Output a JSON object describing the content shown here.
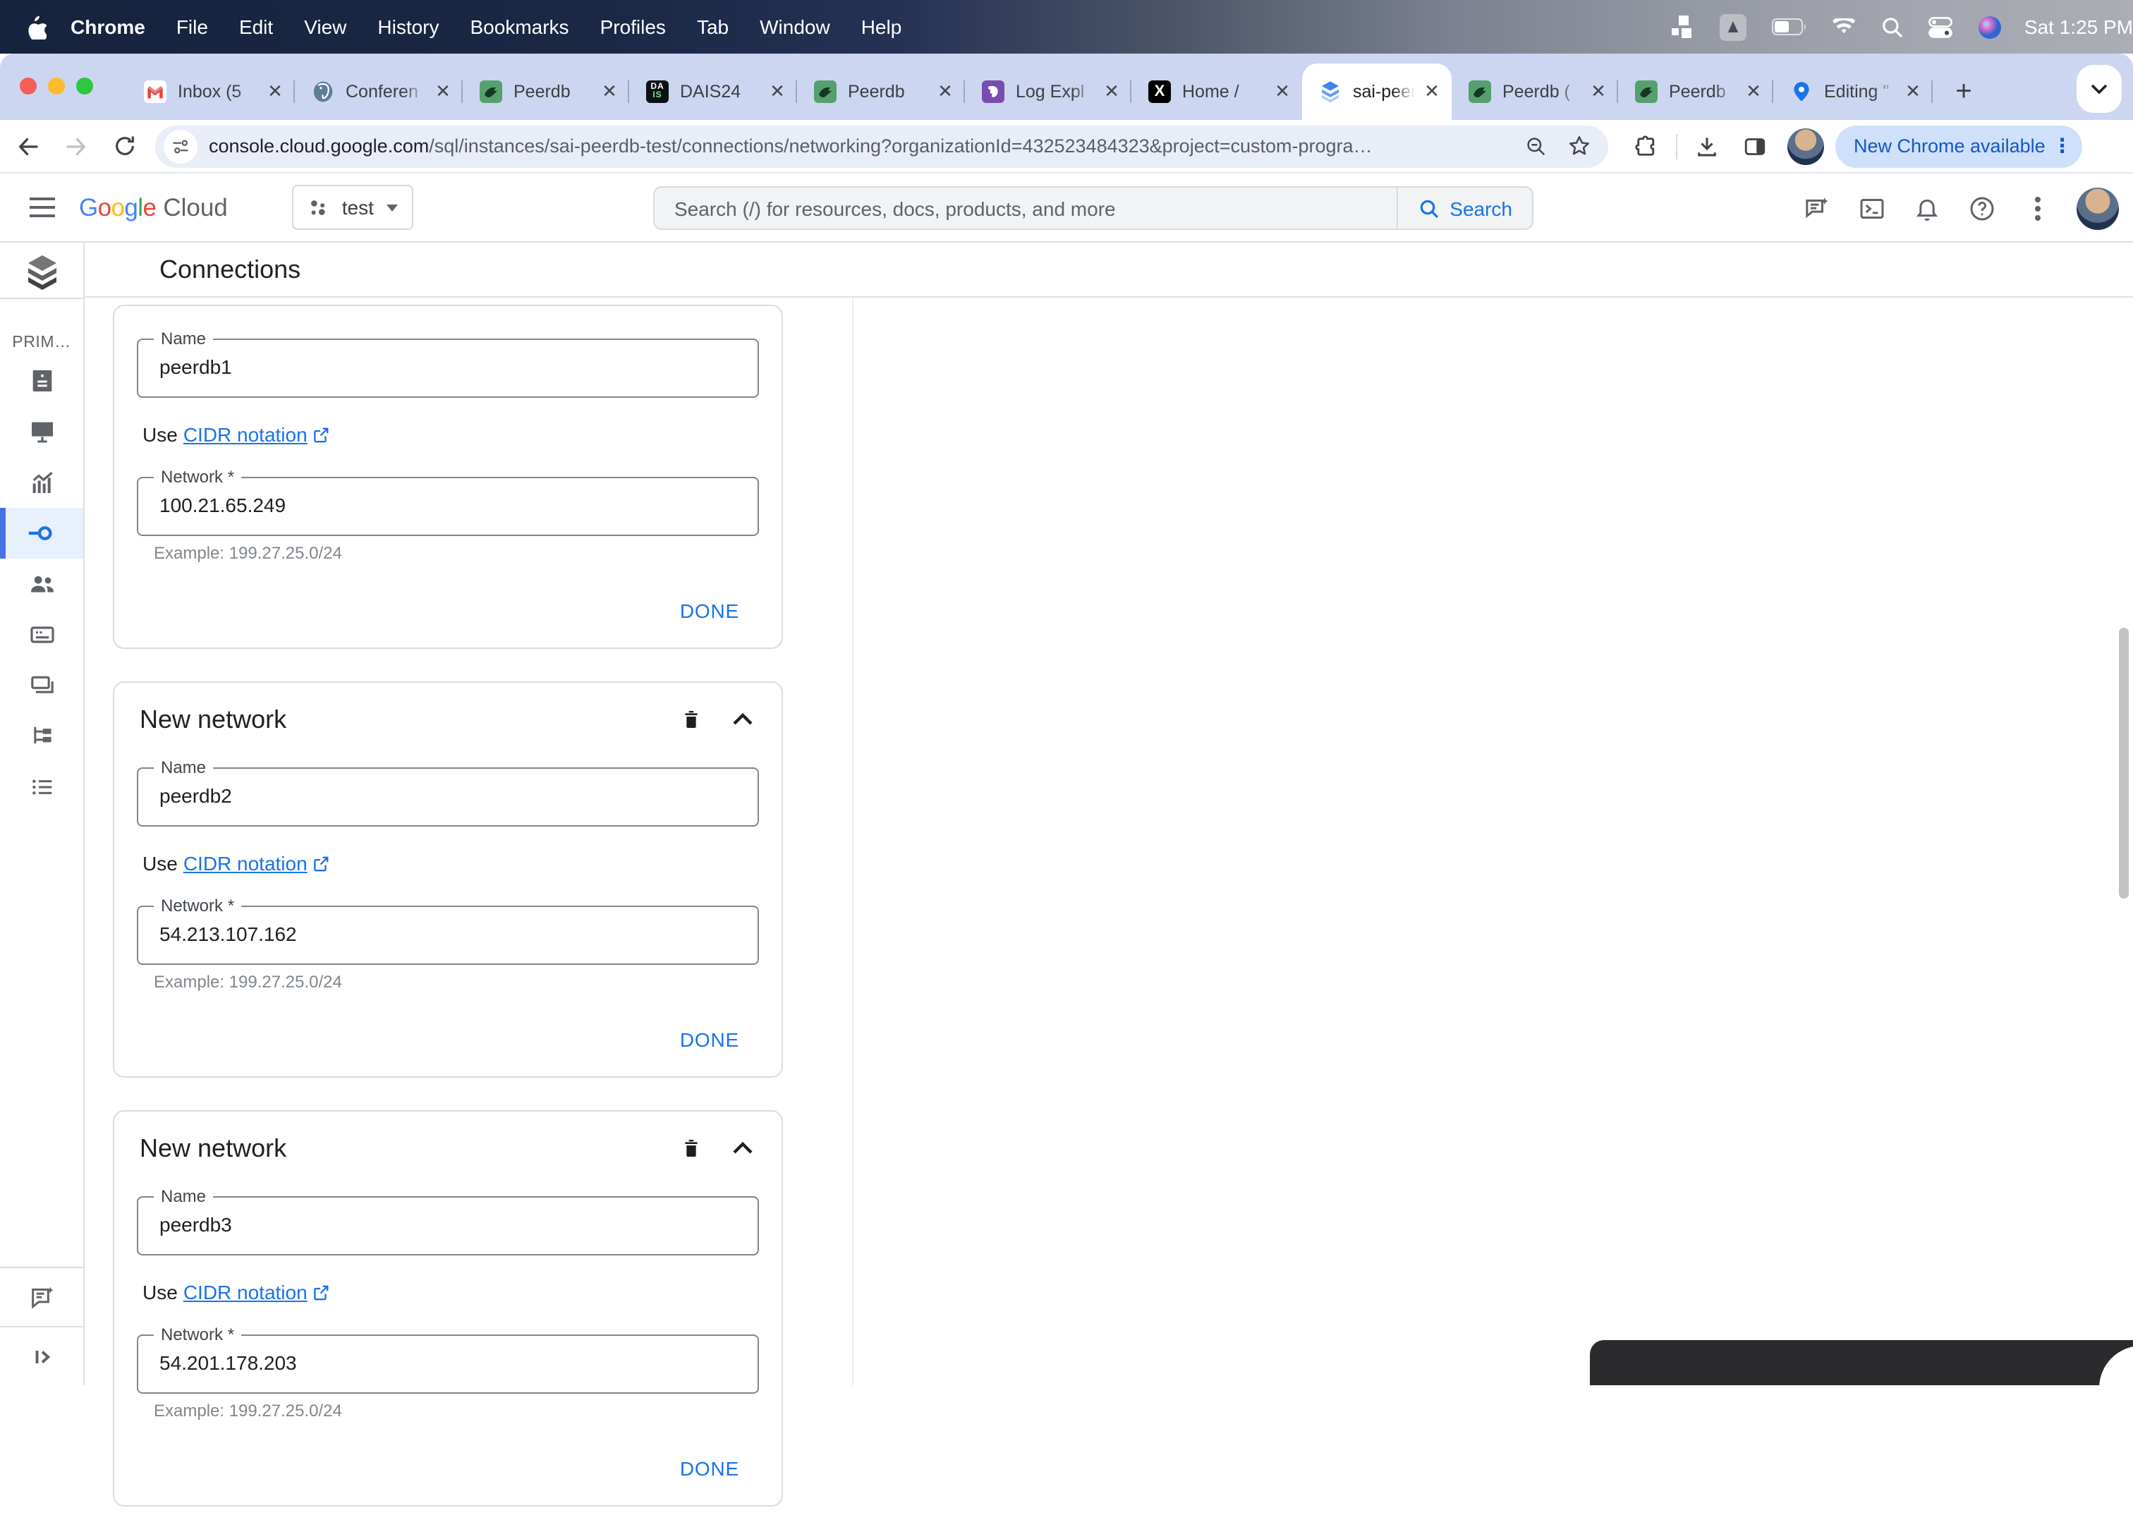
{
  "menubar": {
    "items": [
      "Chrome",
      "File",
      "Edit",
      "View",
      "History",
      "Bookmarks",
      "Profiles",
      "Tab",
      "Window",
      "Help"
    ],
    "clock": "Sat 1:25 PM"
  },
  "tabs": [
    {
      "title": "Inbox (5"
    },
    {
      "title": "Conferen"
    },
    {
      "title": "Peerdb"
    },
    {
      "title": "DAIS24",
      "favicon_lines": [
        "DA",
        "IS"
      ]
    },
    {
      "title": "Peerdb"
    },
    {
      "title": "Log Expl"
    },
    {
      "title": "Home /",
      "favicon_text": "X"
    },
    {
      "title": "sai-peer"
    },
    {
      "title": "Peerdb ("
    },
    {
      "title": "Peerdb"
    },
    {
      "title": "Editing \""
    }
  ],
  "toolbar": {
    "url_domain": "console.cloud.google.com",
    "url_path": "/sql/instances/sai-peerdb-test/connections/networking?organizationId=432523484323&project=custom-progra…",
    "update_button": "New Chrome available"
  },
  "appbar": {
    "logo_google": "Google",
    "logo_google_colors": [
      "#4285F4",
      "#EA4335",
      "#FBBC05",
      "#4285F4",
      "#34A853",
      "#EA4335"
    ],
    "logo_cloud": "Cloud",
    "project_name": "test",
    "search_placeholder": "Search (/) for resources, docs, products, and more",
    "search_button": "Search"
  },
  "sidebar": {
    "section_label": "PRIM…"
  },
  "page": {
    "title": "Connections"
  },
  "cards": [
    {
      "name_label": "Name",
      "name_value": "peerdb1",
      "use_prefix": "Use",
      "cidr_link": "CIDR notation",
      "network_label": "Network *",
      "network_value": "100.21.65.249",
      "example": "Example: 199.27.25.0/24",
      "done_label": "DONE"
    },
    {
      "header": "New network",
      "name_label": "Name",
      "name_value": "peerdb2",
      "use_prefix": "Use",
      "cidr_link": "CIDR notation",
      "network_label": "Network *",
      "network_value": "54.213.107.162",
      "example": "Example: 199.27.25.0/24",
      "done_label": "DONE"
    },
    {
      "header": "New network",
      "name_label": "Name",
      "name_value": "peerdb3",
      "use_prefix": "Use",
      "cidr_link": "CIDR notation",
      "network_label": "Network *",
      "network_value": "54.201.178.203",
      "example": "Example: 199.27.25.0/24",
      "done_label": "DONE"
    }
  ]
}
